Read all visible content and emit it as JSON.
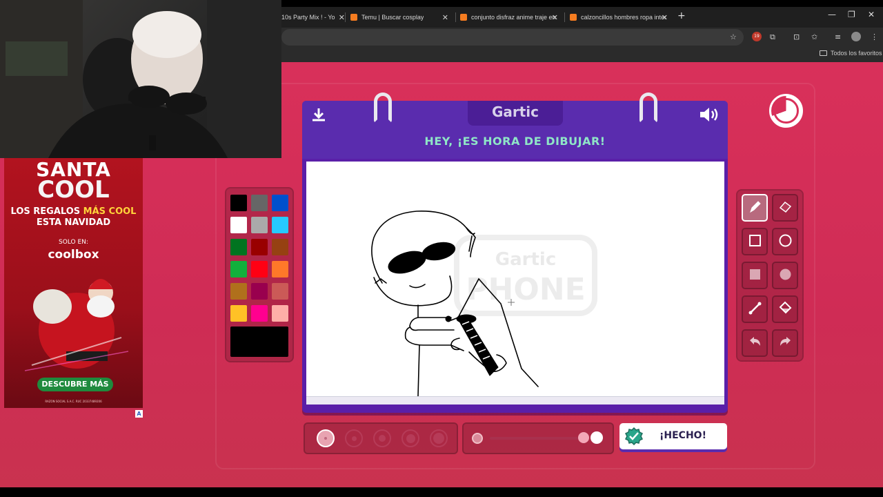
{
  "browser": {
    "tabs": [
      {
        "label": "10s Party Mix ! - Yo"
      },
      {
        "label": "Temu | Buscar cosplay"
      },
      {
        "label": "conjunto disfraz anime traje en"
      },
      {
        "label": "calzoncillos hombres ropa inter"
      }
    ],
    "bookmarks_folder": "Todos los favoritos",
    "extension_badge": "19"
  },
  "ad": {
    "title_line1": "SANTA",
    "title_line2": "COOL",
    "subtitle_pre": "LOS REGALOS ",
    "subtitle_highlight": "MÁS COOL",
    "subtitle_line2": "ESTA NAVIDAD",
    "solo_en": "SOLO EN:",
    "brand": "coolbox",
    "cta": "DESCUBRE MÁS",
    "fine_print": "RAZON SOCIAL S.A.C. RUC 20337489206",
    "badge": "A"
  },
  "game": {
    "logo": "Gartic",
    "heading": "HEY, ¡ES HORA DE DIBUJAR!",
    "done_label": "¡HECHO!",
    "watermark_line1": "Gartic",
    "watermark_line2": "PHONE",
    "palette": [
      "#000000",
      "#666666",
      "#0050cd",
      "#ffffff",
      "#aaaaaa",
      "#26c9ff",
      "#017420",
      "#990000",
      "#964112",
      "#11b03c",
      "#ff0013",
      "#ff7829",
      "#b0701c",
      "#99004e",
      "#cb5a57",
      "#ffc126",
      "#ff008f",
      "#feafa8"
    ],
    "current_color": "#000000",
    "tools": [
      {
        "name": "pen-tool",
        "icon": "pencil-icon",
        "active": true
      },
      {
        "name": "eraser-tool",
        "icon": "eraser-icon",
        "active": false
      },
      {
        "name": "rectangle-outline-tool",
        "icon": "square-outline-icon",
        "active": false
      },
      {
        "name": "ellipse-outline-tool",
        "icon": "circle-outline-icon",
        "active": false
      },
      {
        "name": "rectangle-fill-tool",
        "icon": "square-filled-icon",
        "active": false
      },
      {
        "name": "ellipse-fill-tool",
        "icon": "circle-filled-icon",
        "active": false
      },
      {
        "name": "line-tool",
        "icon": "line-icon",
        "active": false
      },
      {
        "name": "fill-bucket-tool",
        "icon": "bucket-icon",
        "active": false
      },
      {
        "name": "undo-button",
        "icon": "undo-icon",
        "active": false
      },
      {
        "name": "redo-button",
        "icon": "redo-icon",
        "active": false
      }
    ],
    "brush_sizes": 5,
    "selected_size_index": 0,
    "opacity_level": 1.0
  }
}
